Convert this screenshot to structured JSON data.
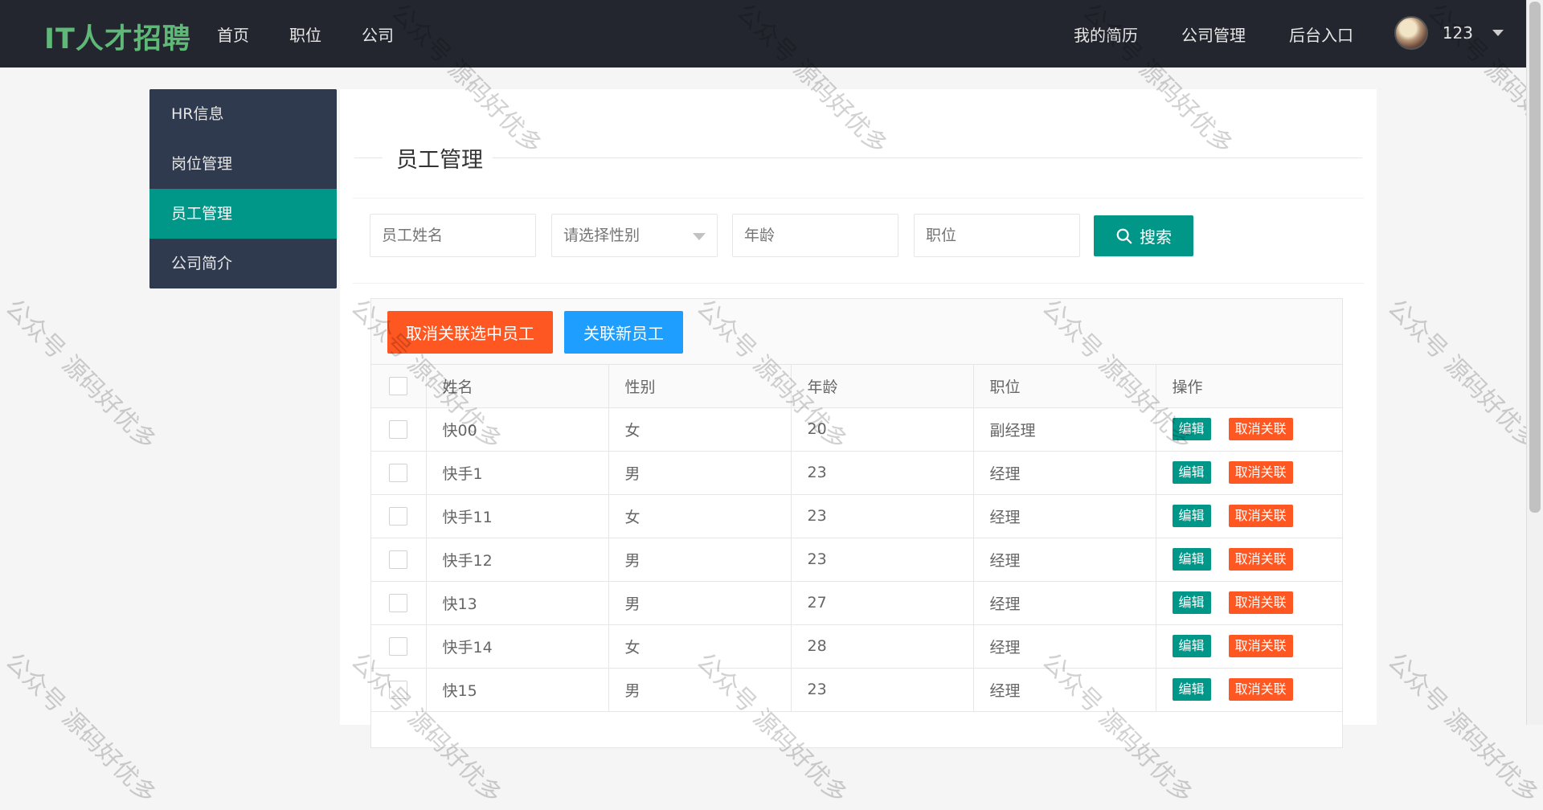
{
  "header": {
    "brand": "IT人才招聘",
    "nav_left": [
      "首页",
      "职位",
      "公司"
    ],
    "nav_right": [
      "我的简历",
      "公司管理",
      "后台入口"
    ],
    "user_name": "123"
  },
  "sidebar": {
    "items": [
      {
        "label": "HR信息",
        "active": false
      },
      {
        "label": "岗位管理",
        "active": false
      },
      {
        "label": "员工管理",
        "active": true
      },
      {
        "label": "公司简介",
        "active": false
      }
    ]
  },
  "main": {
    "page_title": "员工管理",
    "search": {
      "name_placeholder": "员工姓名",
      "gender_placeholder": "请选择性别",
      "age_placeholder": "年龄",
      "position_placeholder": "职位",
      "search_label": "搜索"
    },
    "toolbar": {
      "unlink_selected_label": "取消关联选中员工",
      "link_new_label": "关联新员工"
    },
    "table": {
      "columns": [
        "姓名",
        "性别",
        "年龄",
        "职位",
        "操作"
      ],
      "actions": {
        "edit": "编辑",
        "unlink": "取消关联"
      },
      "rows": [
        {
          "name": "快00",
          "gender": "女",
          "age": "20",
          "position": "副经理"
        },
        {
          "name": "快手1",
          "gender": "男",
          "age": "23",
          "position": "经理"
        },
        {
          "name": "快手11",
          "gender": "女",
          "age": "23",
          "position": "经理"
        },
        {
          "name": "快手12",
          "gender": "男",
          "age": "23",
          "position": "经理"
        },
        {
          "name": "快13",
          "gender": "男",
          "age": "27",
          "position": "经理"
        },
        {
          "name": "快手14",
          "gender": "女",
          "age": "28",
          "position": "经理"
        },
        {
          "name": "快15",
          "gender": "男",
          "age": "23",
          "position": "经理"
        }
      ]
    }
  },
  "watermark": {
    "text": "公众号 源码好优多"
  },
  "colors": {
    "topbar": "#23262e",
    "brand": "#5fb878",
    "sidebar": "#2f3a4f",
    "active": "#009688",
    "danger": "#ff5722",
    "info": "#1e9fff"
  }
}
